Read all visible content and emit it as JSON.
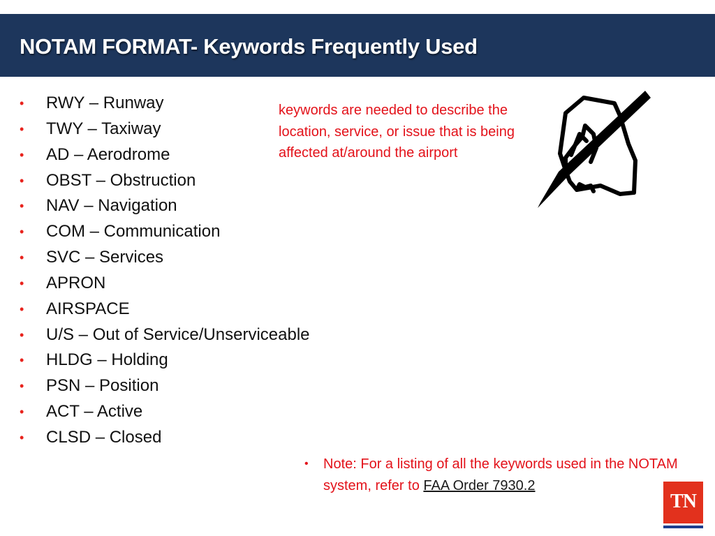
{
  "slide": {
    "title": "NOTAM FORMAT- Keywords Frequently Used",
    "keywords": [
      {
        "text": "RWY – Runway"
      },
      {
        "text": "TWY – Taxiway"
      },
      {
        "text": "AD – Aerodrome"
      },
      {
        "text": "OBST – Obstruction"
      },
      {
        "text": "NAV – Navigation"
      },
      {
        "text": "COM – Communication"
      },
      {
        "text": "SVC – Services"
      },
      {
        "text": "APRON"
      },
      {
        "text": "AIRSPACE"
      },
      {
        "text": "U/S – Out of Service/Unserviceable"
      },
      {
        "text": "HLDG – Holding"
      },
      {
        "text": "PSN – Position"
      },
      {
        "text": "ACT – Active"
      },
      {
        "text": "CLSD – Closed"
      }
    ],
    "bullet_glyph": "•",
    "callout": "keywords are needed to describe the location, service, or issue that is being affected at/around the airport",
    "note": {
      "prefix": "Note: For a listing of all the keywords used in the NOTAM system, refer to ",
      "link_text": "FAA Order 7930.2"
    },
    "icons": {
      "illustration": "hand-writing-with-pen-icon",
      "logo": "tn-logo"
    },
    "logo_text": "TN",
    "colors": {
      "title_bar": "#1d365c",
      "accent_red": "#e3121a",
      "bullet_red": "#e8231d",
      "logo_red": "#e2311d",
      "logo_blue": "#1d3f8f"
    }
  }
}
